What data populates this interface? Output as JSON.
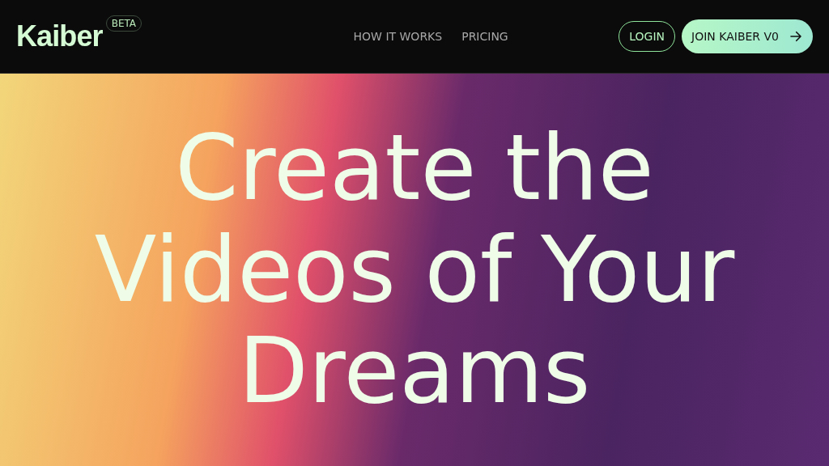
{
  "header": {
    "logo": "Kaiber",
    "badge": "BETA",
    "nav": [
      "HOW IT WORKS",
      "PRICING"
    ],
    "login": "LOGIN",
    "join": "JOIN KAIBER V0"
  },
  "hero": {
    "headline": [
      "Create the",
      "Videos of Your",
      "Dreams"
    ]
  }
}
